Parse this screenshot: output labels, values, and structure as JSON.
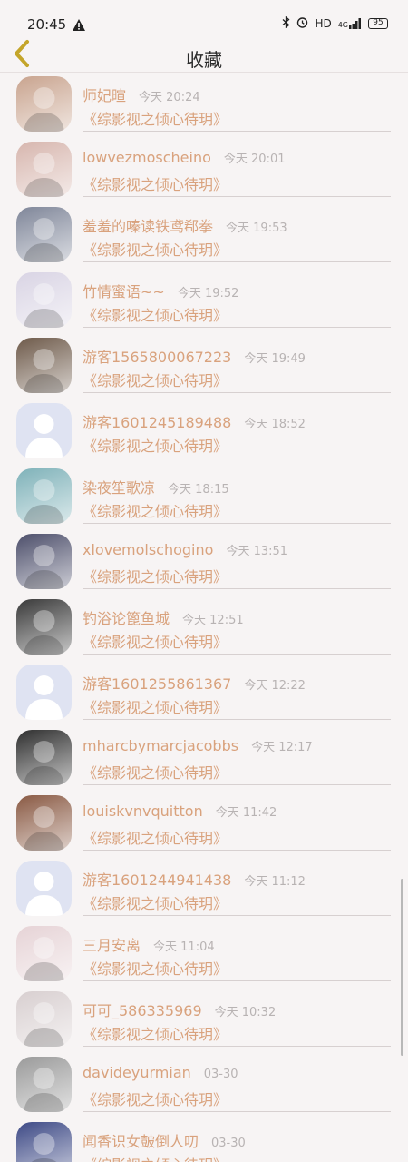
{
  "status_bar": {
    "time": "20:45",
    "hd_label": "HD",
    "signal_label": "4G",
    "battery": "95"
  },
  "header": {
    "title": "收藏"
  },
  "items": [
    {
      "name": "师妃暄",
      "time": "今天 20:24",
      "book": "《综影视之倾心待玥》",
      "avatar": "photo",
      "avatar_color": "#c9a48f"
    },
    {
      "name": "lowvezmoscheino",
      "time": "今天 20:01",
      "book": "《综影视之倾心待玥》",
      "avatar": "photo",
      "avatar_color": "#d7b6ae"
    },
    {
      "name": "羞羞的嗪读铁鸢郗拳",
      "time": "今天 19:53",
      "book": "《综影视之倾心待玥》",
      "avatar": "photo",
      "avatar_color": "#7f8699"
    },
    {
      "name": "竹情蜜语~~",
      "time": "今天 19:52",
      "book": "《综影视之倾心待玥》",
      "avatar": "photo",
      "avatar_color": "#d9d4e4"
    },
    {
      "name": "游客1565800067223",
      "time": "今天 19:49",
      "book": "《综影视之倾心待玥》",
      "avatar": "photo",
      "avatar_color": "#6e5a4a"
    },
    {
      "name": "游客1601245189488",
      "time": "今天 18:52",
      "book": "《综影视之倾心待玥》",
      "avatar": "default",
      "avatar_color": "#dfe3f2"
    },
    {
      "name": "染夜笙歌凉",
      "time": "今天 18:15",
      "book": "《综影视之倾心待玥》",
      "avatar": "photo",
      "avatar_color": "#7fb2b9"
    },
    {
      "name": "xlovemolschogino",
      "time": "今天 13:51",
      "book": "《综影视之倾心待玥》",
      "avatar": "photo",
      "avatar_color": "#4d4f6b"
    },
    {
      "name": "钓浴论篦鱼城",
      "time": "今天 12:51",
      "book": "《综影视之倾心待玥》",
      "avatar": "photo",
      "avatar_color": "#3a3a3a"
    },
    {
      "name": "游客1601255861367",
      "time": "今天 12:22",
      "book": "《综影视之倾心待玥》",
      "avatar": "default",
      "avatar_color": "#dfe3f2"
    },
    {
      "name": "mharcbymarcjacobbs",
      "time": "今天 12:17",
      "book": "《综影视之倾心待玥》",
      "avatar": "photo",
      "avatar_color": "#2f2f2f"
    },
    {
      "name": "louiskvnvquitton",
      "time": "今天 11:42",
      "book": "《综影视之倾心待玥》",
      "avatar": "photo",
      "avatar_color": "#8a5a44"
    },
    {
      "name": "游客1601244941438",
      "time": "今天 11:12",
      "book": "《综影视之倾心待玥》",
      "avatar": "default",
      "avatar_color": "#dfe3f2"
    },
    {
      "name": "三月安离",
      "time": "今天 11:04",
      "book": "《综影视之倾心待玥》",
      "avatar": "photo",
      "avatar_color": "#e6d3d6"
    },
    {
      "name": "可可_586335969",
      "time": "今天 10:32",
      "book": "《综影视之倾心待玥》",
      "avatar": "photo",
      "avatar_color": "#d8cfd0"
    },
    {
      "name": "davideyurmian",
      "time": "03-30",
      "book": "《综影视之倾心待玥》",
      "avatar": "photo",
      "avatar_color": "#9a9a9a"
    },
    {
      "name": "闻香识女皷倒人叨",
      "time": "03-30",
      "book": "《综影视之倾心待玥》",
      "avatar": "photo",
      "avatar_color": "#3e4a86"
    }
  ]
}
